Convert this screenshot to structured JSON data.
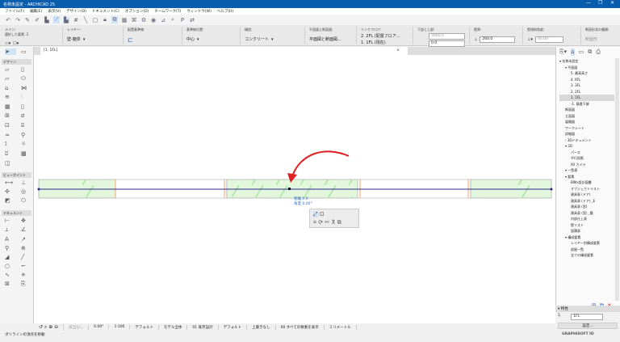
{
  "window": {
    "title": "名称未設定 - ARCHICAD 25",
    "controls": [
      "—",
      "❐",
      "✕"
    ]
  },
  "menu": [
    "ファイル(F)",
    "編集(E)",
    "表示(V)",
    "デザイン(D)",
    "ドキュメント(C)",
    "オプション(O)",
    "チームワーク(T)",
    "ウィンドウ(W)",
    "ヘルプ(H)"
  ],
  "infobox": {
    "main_label": "メイン:",
    "selected": "選択した要素: 2",
    "layer_label": "レイヤー:",
    "layer": "壁-躯体",
    "ref_label": "配置基準線:",
    "refline_label": "基準線位置:",
    "refline": "中心",
    "struct_label": "構造:",
    "struct": "コンクリート",
    "plan_label": "平面図と断面図:",
    "plan": "平面図と断面図...",
    "story_label": "リンクフロア:",
    "top_story": "2. 2FL (配置フロア...",
    "home_story": "1. 1FL (現在)",
    "topbot_label": "下部と上部:",
    "top": "3000.0",
    "bottom": "0.0",
    "thick_label": "壁厚:",
    "thick": "260.0",
    "slant_label": "壁傾斜角度:",
    "slant": "90.00°",
    "profile_label": "断面形状の種類:",
    "profile": "断面形"
  },
  "tab": {
    "label": "[1. 1FL]",
    "close": "×"
  },
  "toolbox": {
    "sections": [
      "デザイン",
      "ビューポイント",
      "ドキュメント"
    ]
  },
  "canvas": {
    "dim1": "距離 0.0",
    "dim2": "角度 0.00°"
  },
  "navigator": {
    "tree": [
      {
        "t": "▾ 名称未設定",
        "l": 0
      },
      {
        "t": "▾ 平面図",
        "l": 1
      },
      {
        "t": "5. 最高高さ",
        "l": 2
      },
      {
        "t": "4. RFL",
        "l": 2
      },
      {
        "t": "3. 3FL",
        "l": 2
      },
      {
        "t": "2. 2FL",
        "l": 2
      },
      {
        "t": "1. 1FL",
        "l": 2,
        "sel": true
      },
      {
        "t": "-1. 基礎下端",
        "l": 2
      },
      {
        "t": "断面図",
        "l": 1
      },
      {
        "t": "立面図",
        "l": 1
      },
      {
        "t": "展開図",
        "l": 1
      },
      {
        "t": "ワークシート",
        "l": 1
      },
      {
        "t": "詳細図",
        "l": 1
      },
      {
        "t": "› 3Dドキュメント",
        "l": 1
      },
      {
        "t": "▾ 3D",
        "l": 1
      },
      {
        "t": "パース",
        "l": 2
      },
      {
        "t": "平行投影",
        "l": 2
      },
      {
        "t": "00 カメラ",
        "l": 2
      },
      {
        "t": "▾ 一覧表",
        "l": 1
      },
      {
        "t": "▾ 要素",
        "l": 1
      },
      {
        "t": "BIMx設計図書",
        "l": 2
      },
      {
        "t": "オブジェクトリスト",
        "l": 2
      },
      {
        "t": "建具表 (ドア)",
        "l": 2
      },
      {
        "t": "建具表 (ドア) _E",
        "l": 2
      },
      {
        "t": "建具表 (窓)",
        "l": 2
      },
      {
        "t": "建具表 (窓) _簡",
        "l": 2
      },
      {
        "t": "内部仕上表",
        "l": 2
      },
      {
        "t": "壁リスト",
        "l": 2
      },
      {
        "t": "面積表",
        "l": 2
      },
      {
        "t": "▾ 構成要素",
        "l": 1
      },
      {
        "t": "レイヤー別構成要素",
        "l": 2
      },
      {
        "t": "部屋一覧",
        "l": 2
      },
      {
        "t": "全ての構成要素",
        "l": 2
      }
    ]
  },
  "properties": {
    "title": "▾ 特性",
    "story_num": "1.",
    "story_name": "1FL",
    "settings": "設定...",
    "graphisoft": "GRAPHISOFT ID"
  },
  "status": [
    "該当なし",
    "0.00°",
    "1:100",
    "デフォルト",
    "モデル全体",
    "01 既存設計",
    "デフォルト",
    "上書きなし",
    "00 すべての要素を表示",
    "ミリメートル"
  ],
  "message": "ポリラインの頂点を移動",
  "colors": {
    "accent": "#0a5cad",
    "wall_fill": "#e2f7dc",
    "axis": "#2b2b8c",
    "arrow": "#e02020"
  }
}
